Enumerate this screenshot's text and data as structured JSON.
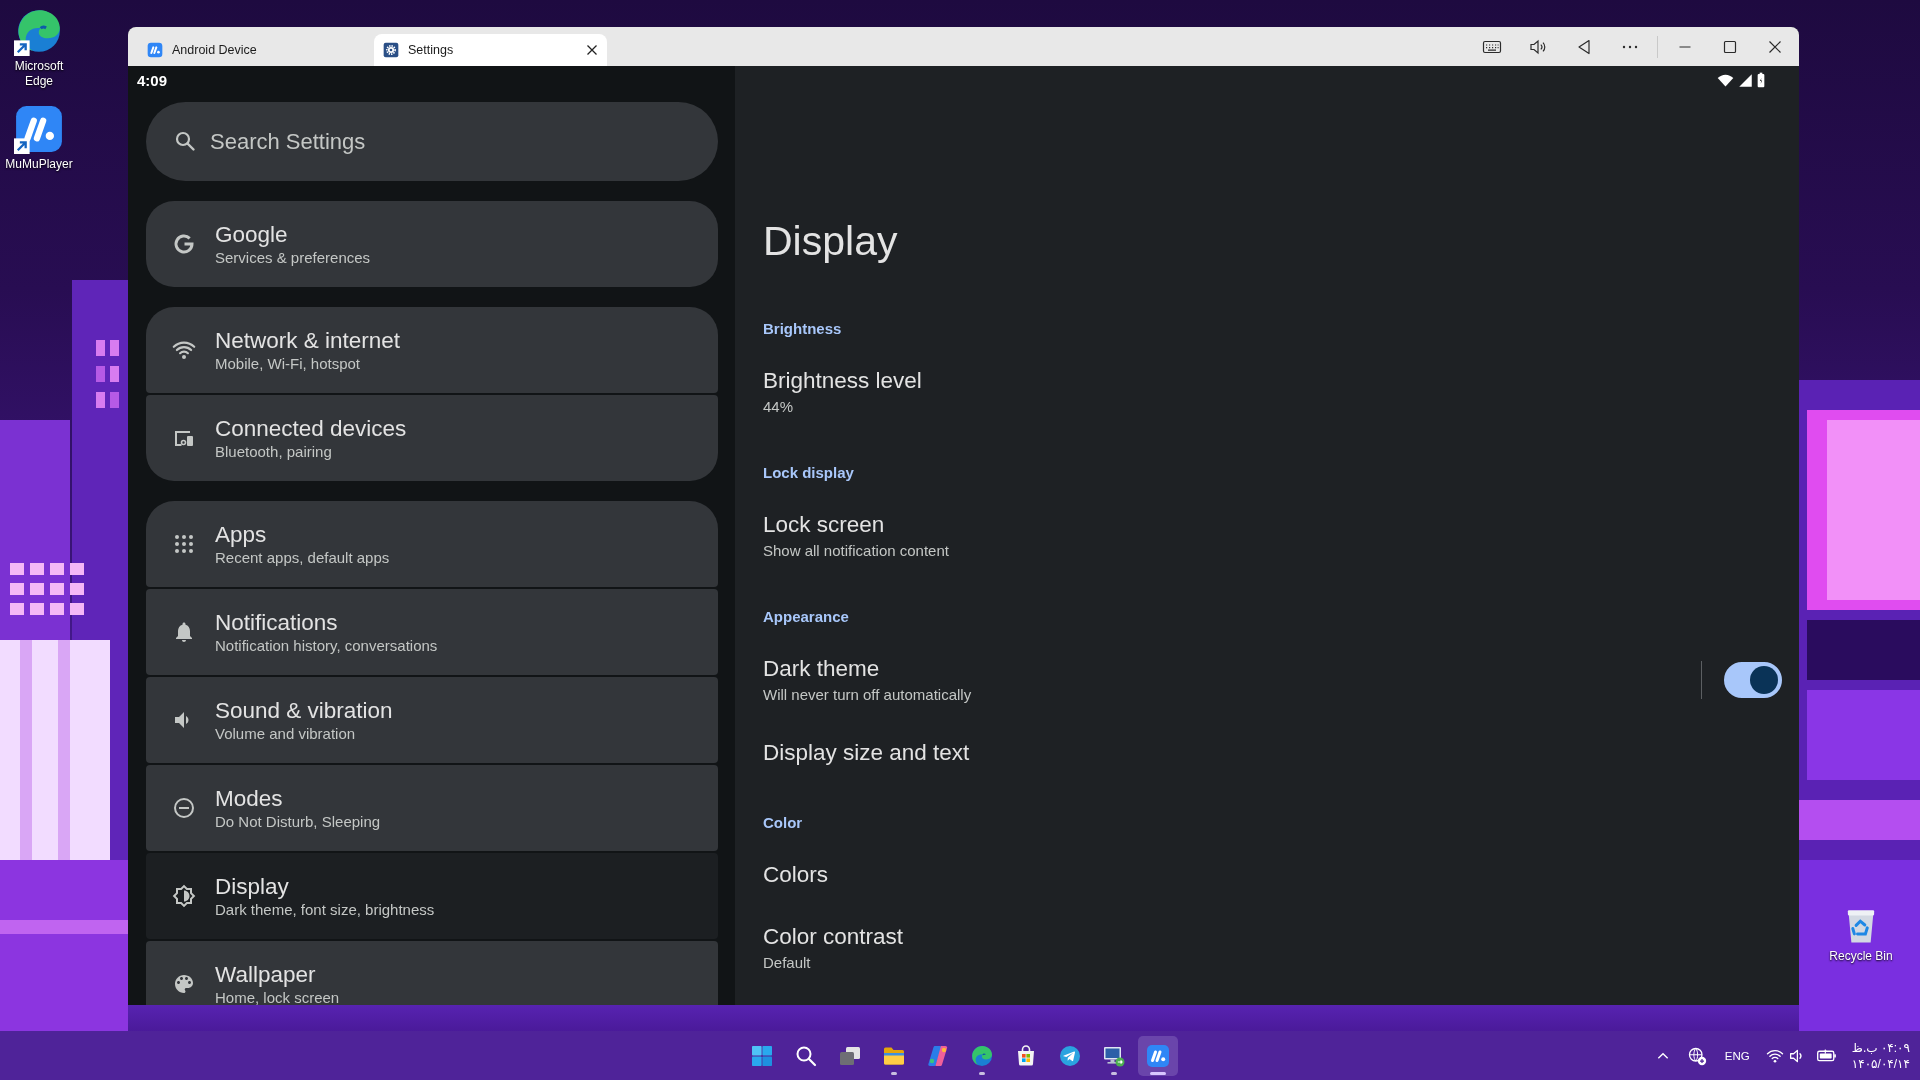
{
  "desktop": {
    "icons": [
      {
        "kind": "edge",
        "label": "Microsoft Edge",
        "shortcut": true
      },
      {
        "kind": "mumu",
        "label": "MuMuPlayer",
        "shortcut": true
      },
      {
        "kind": "bin",
        "label": "Recycle Bin",
        "shortcut": false
      }
    ]
  },
  "window": {
    "tabs": [
      {
        "kind": "device",
        "label": "Android Device",
        "selected": false
      },
      {
        "kind": "settings",
        "label": "Settings",
        "selected": true
      }
    ]
  },
  "status_bar": {
    "time": "4:09"
  },
  "search": {
    "placeholder": "Search Settings"
  },
  "sidebar": {
    "groups": [
      {
        "items": [
          {
            "kind": "google",
            "title": "Google",
            "subtitle": "Services & preferences",
            "selected": false
          }
        ]
      },
      {
        "items": [
          {
            "kind": "wifi",
            "title": "Network & internet",
            "subtitle": "Mobile, Wi-Fi, hotspot",
            "selected": false
          },
          {
            "kind": "devices",
            "title": "Connected devices",
            "subtitle": "Bluetooth, pairing",
            "selected": false
          }
        ]
      },
      {
        "items": [
          {
            "kind": "apps",
            "title": "Apps",
            "subtitle": "Recent apps, default apps",
            "selected": false
          },
          {
            "kind": "bell",
            "title": "Notifications",
            "subtitle": "Notification history, conversations",
            "selected": false
          },
          {
            "kind": "sound",
            "title": "Sound & vibration",
            "subtitle": "Volume and vibration",
            "selected": false
          },
          {
            "kind": "modes",
            "title": "Modes",
            "subtitle": "Do Not Disturb, Sleeping",
            "selected": false
          },
          {
            "kind": "display",
            "title": "Display",
            "subtitle": "Dark theme, font size, brightness",
            "selected": true
          },
          {
            "kind": "palette",
            "title": "Wallpaper",
            "subtitle": "Home, lock screen",
            "selected": false
          }
        ]
      }
    ]
  },
  "detail": {
    "title": "Display",
    "sections": [
      {
        "header": "Brightness",
        "rows": [
          {
            "kind": "text",
            "title": "Brightness level",
            "subtitle": "44%"
          }
        ]
      },
      {
        "header": "Lock display",
        "rows": [
          {
            "kind": "text",
            "title": "Lock screen",
            "subtitle": "Show all notification content"
          }
        ]
      },
      {
        "header": "Appearance",
        "rows": [
          {
            "kind": "switch",
            "title": "Dark theme",
            "subtitle": "Will never turn off automatically",
            "on": true
          },
          {
            "kind": "text",
            "title": "Display size and text"
          }
        ]
      },
      {
        "header": "Color",
        "rows": [
          {
            "kind": "text",
            "title": "Colors"
          },
          {
            "kind": "text",
            "title": "Color contrast",
            "subtitle": "Default"
          }
        ]
      }
    ]
  },
  "taskbar": {
    "apps": [
      {
        "kind": "start",
        "running": false,
        "selected": false
      },
      {
        "kind": "search",
        "running": false,
        "selected": false
      },
      {
        "kind": "taskview",
        "running": false,
        "selected": false
      },
      {
        "kind": "explorer",
        "running": true,
        "selected": false
      },
      {
        "kind": "copilot",
        "running": false,
        "selected": false
      },
      {
        "kind": "edge",
        "running": true,
        "selected": false
      },
      {
        "kind": "store",
        "running": false,
        "selected": false
      },
      {
        "kind": "telegram",
        "running": false,
        "selected": false
      },
      {
        "kind": "remote",
        "running": true,
        "selected": false
      },
      {
        "kind": "mumu",
        "running": true,
        "selected": true
      }
    ],
    "tray": {
      "language": "ENG",
      "time": "۰۴:۰۹ ب.ظ",
      "date": "۱۴۰۵/۰۴/۱۴"
    }
  }
}
